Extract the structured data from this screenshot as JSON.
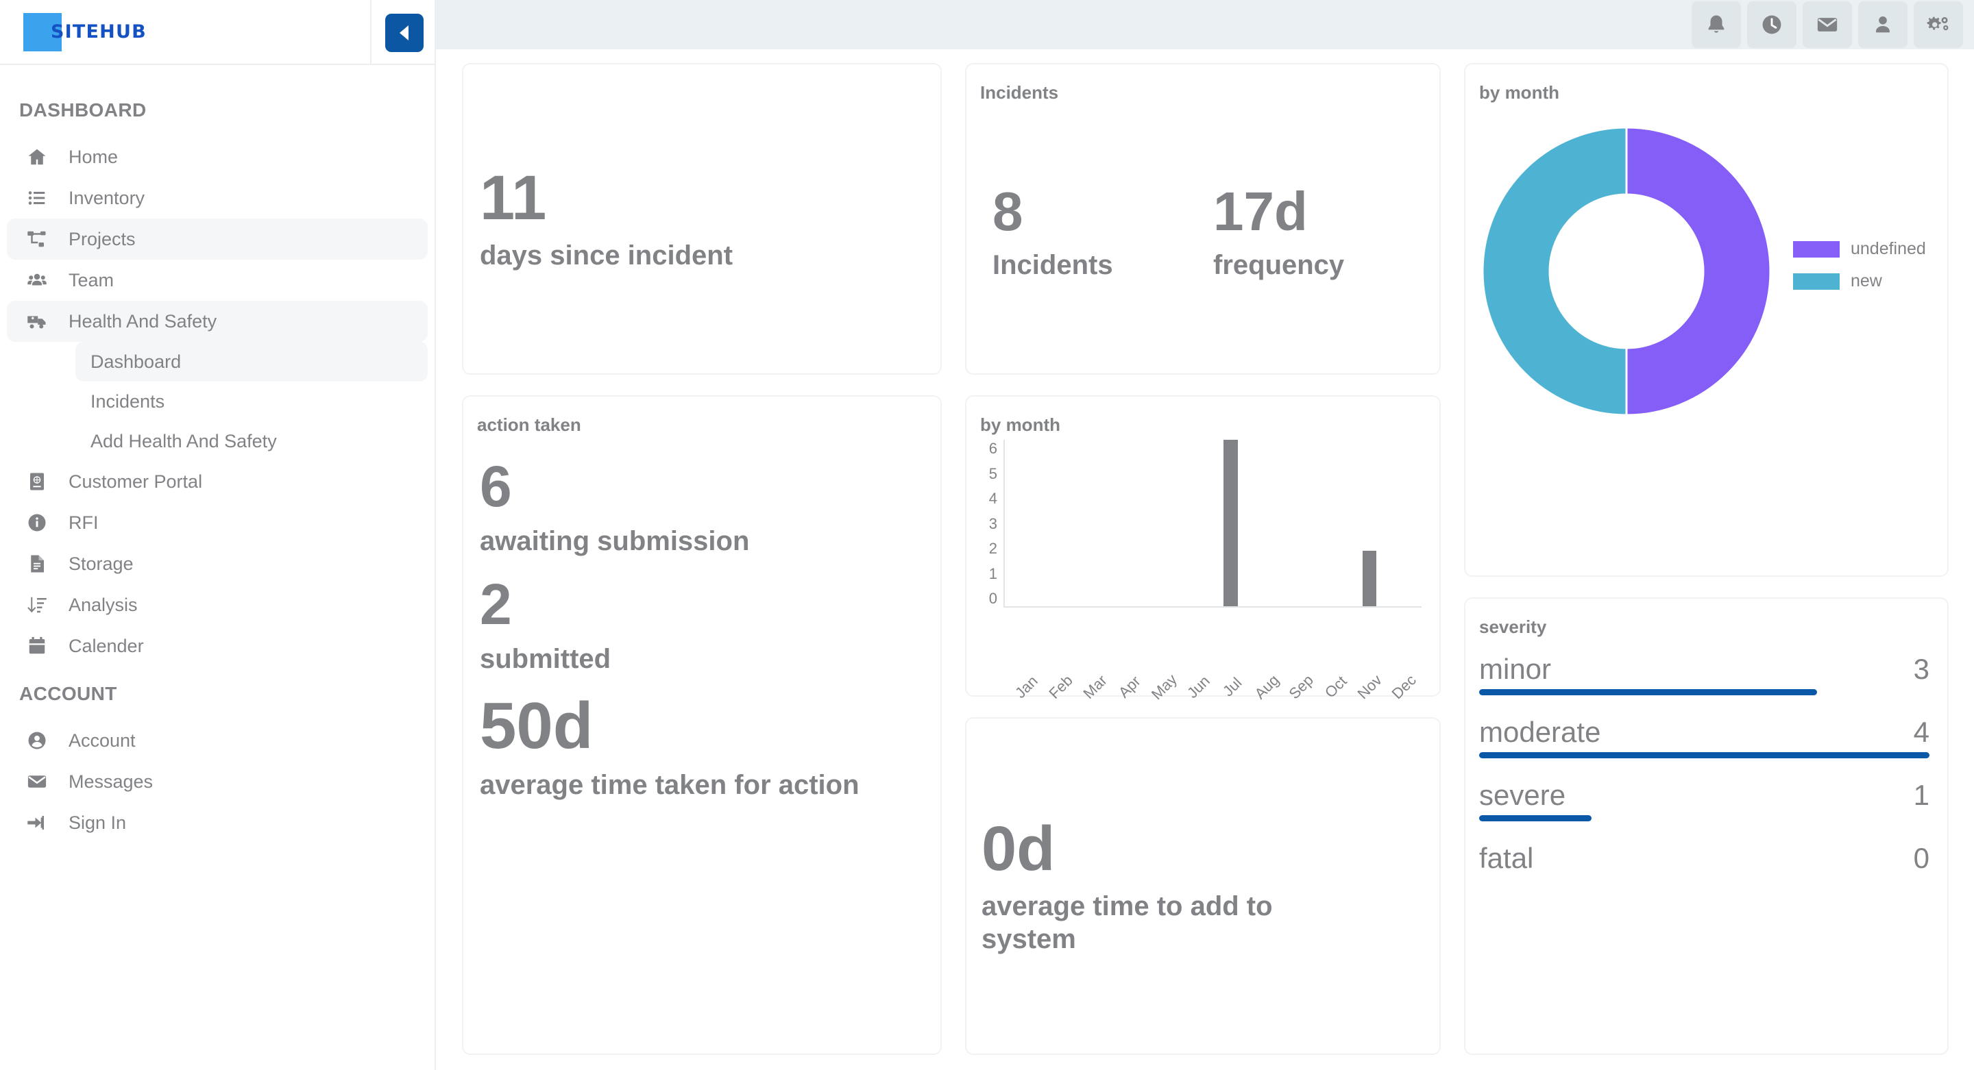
{
  "brand": {
    "logo_text": "SITEHUB",
    "logo_square_color": "#3ba3ee",
    "logo_text_color": "#1452c4"
  },
  "sidebar": {
    "collapse_button_label": "collapse sidebar",
    "sections": [
      {
        "title": "DASHBOARD",
        "items": [
          {
            "label": "Home",
            "icon": "home-icon",
            "active": false
          },
          {
            "label": "Inventory",
            "icon": "list-icon",
            "active": false
          },
          {
            "label": "Projects",
            "icon": "project-tree-icon",
            "active": true
          },
          {
            "label": "Team",
            "icon": "people-icon",
            "active": false
          },
          {
            "label": "Health And Safety",
            "icon": "ambulance-icon",
            "active": true,
            "children": [
              {
                "label": "Dashboard",
                "active": true
              },
              {
                "label": "Incidents",
                "active": false
              },
              {
                "label": "Add Health And Safety",
                "active": false
              }
            ]
          },
          {
            "label": "Customer Portal",
            "icon": "portal-icon",
            "active": false
          },
          {
            "label": "RFI",
            "icon": "info-icon",
            "active": false
          },
          {
            "label": "Storage",
            "icon": "document-icon",
            "active": false
          },
          {
            "label": "Analysis",
            "icon": "sort-analysis-icon",
            "active": false
          },
          {
            "label": "Calender",
            "icon": "calendar-icon",
            "active": false
          }
        ]
      },
      {
        "title": "ACCOUNT",
        "items": [
          {
            "label": "Account",
            "icon": "user-circle-icon",
            "active": false
          },
          {
            "label": "Messages",
            "icon": "envelope-icon",
            "active": false
          },
          {
            "label": "Sign In",
            "icon": "sign-in-icon",
            "active": false
          }
        ]
      }
    ]
  },
  "topbar": {
    "buttons": [
      {
        "name": "notifications-button",
        "icon": "bell-icon"
      },
      {
        "name": "history-button",
        "icon": "clock-icon"
      },
      {
        "name": "messages-button",
        "icon": "envelope-icon"
      },
      {
        "name": "profile-button",
        "icon": "person-icon"
      },
      {
        "name": "settings-button",
        "icon": "gears-icon"
      }
    ]
  },
  "cards": {
    "days_since_incident": {
      "value": "11",
      "label": "days since incident"
    },
    "incidents": {
      "title": "Incidents",
      "count": {
        "value": "8",
        "label": "Incidents"
      },
      "frequency": {
        "value": "17d",
        "label": "frequency"
      }
    },
    "action_taken": {
      "title": "action taken",
      "awaiting": {
        "value": "6",
        "label": "awaiting submission"
      },
      "submitted": {
        "value": "2",
        "label": "submitted"
      },
      "avg_action": {
        "value": "50d",
        "label": "average time taken for action"
      }
    },
    "avg_time_to_add": {
      "value": "0d",
      "label": "average time to add to system"
    },
    "severity": {
      "title": "severity"
    }
  },
  "chart_data": [
    {
      "type": "pie",
      "title": "by month",
      "donut": true,
      "legend_position": "right",
      "labels": [
        "undefined",
        "new"
      ],
      "values": [
        50,
        50
      ],
      "colors": [
        "#845ef7",
        "#4eb3d3"
      ]
    },
    {
      "type": "bar",
      "title": "by month",
      "categories": [
        "Jan",
        "Feb",
        "Mar",
        "Apr",
        "May",
        "Jun",
        "Jul",
        "Aug",
        "Sep",
        "Oct",
        "Nov",
        "Dec"
      ],
      "values": [
        0,
        0,
        0,
        0,
        0,
        0,
        6,
        0,
        0,
        0,
        2,
        0
      ],
      "yticks": [
        6,
        5,
        4,
        3,
        2,
        1,
        0
      ],
      "ylim": [
        0,
        6
      ],
      "xlabel": "",
      "ylabel": "",
      "grid": false,
      "bar_color": "#808285"
    },
    {
      "type": "bar",
      "orientation": "horizontal",
      "title": "severity",
      "categories": [
        "minor",
        "moderate",
        "severe",
        "fatal"
      ],
      "values": [
        3,
        4,
        1,
        0
      ],
      "max": 4,
      "bar_color": "#0b57a8"
    }
  ]
}
